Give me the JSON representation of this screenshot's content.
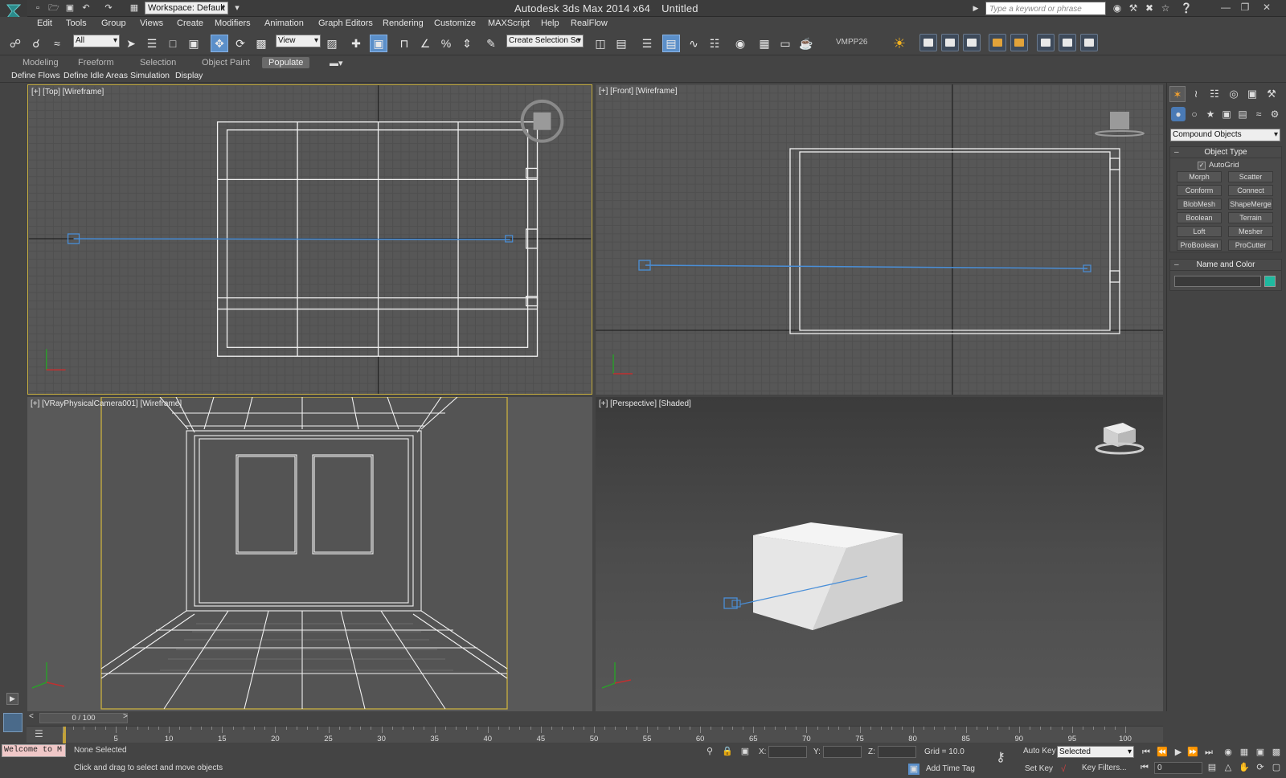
{
  "app": {
    "title": "Autodesk 3ds Max  2014 x64",
    "document": "Untitled",
    "workspace": "Workspace: Default",
    "search_placeholder": "Type a keyword or phrase"
  },
  "menu": [
    "Edit",
    "Tools",
    "Group",
    "Views",
    "Create",
    "Modifiers",
    "Animation",
    "Graph Editors",
    "Rendering",
    "Customize",
    "MAXScript",
    "Help",
    "RealFlow"
  ],
  "toolbar": {
    "selection_filter": "All",
    "reference_coord": "View",
    "named_selection": "Create Selection Se",
    "plugin_label": "VMPP26"
  },
  "ribbon": {
    "tabs": [
      "Modeling",
      "Freeform",
      "Selection",
      "Object Paint",
      "Populate"
    ],
    "active_tab": "Populate",
    "subitems": [
      "Define Flows",
      "Define Idle Areas",
      "Simulation",
      "Display"
    ]
  },
  "viewports": {
    "top": "[+] [Top] [Wireframe]",
    "front": "[+] [Front] [Wireframe]",
    "camera": "[+] [VRayPhysicalCamera001] [Wireframe]",
    "perspective": "[+] [Perspective] [Shaded]"
  },
  "command_panel": {
    "category": "Compound Objects",
    "object_type_title": "Object Type",
    "autogrid_label": "AutoGrid",
    "buttons": [
      "Morph",
      "Scatter",
      "Conform",
      "Connect",
      "BlobMesh",
      "ShapeMerge",
      "Boolean",
      "Terrain",
      "Loft",
      "Mesher",
      "ProBoolean",
      "ProCutter"
    ],
    "name_color_title": "Name and Color",
    "object_color": "#1fb9a0"
  },
  "timeline": {
    "slider": "0 / 100",
    "ticks": [
      "5",
      "10",
      "15",
      "20",
      "25",
      "30",
      "35",
      "40",
      "45",
      "50",
      "55",
      "60",
      "65",
      "70",
      "75",
      "80",
      "85",
      "90",
      "95",
      "100"
    ]
  },
  "status": {
    "selection": "None Selected",
    "prompt": "Click and drag to select and move objects",
    "welcome": "Welcome to M",
    "x_label": "X:",
    "y_label": "Y:",
    "z_label": "Z:",
    "grid": "Grid = 10.0",
    "add_time_tag": "Add Time Tag",
    "auto_key": "Auto Key",
    "set_key": "Set Key",
    "key_mode": "Selected",
    "key_filters": "Key Filters...",
    "current_frame": "0"
  },
  "colors": {
    "accent": "#5b8fc9",
    "active_viewport_border": "#c8b040",
    "camera_line": "#4a8fd8"
  }
}
